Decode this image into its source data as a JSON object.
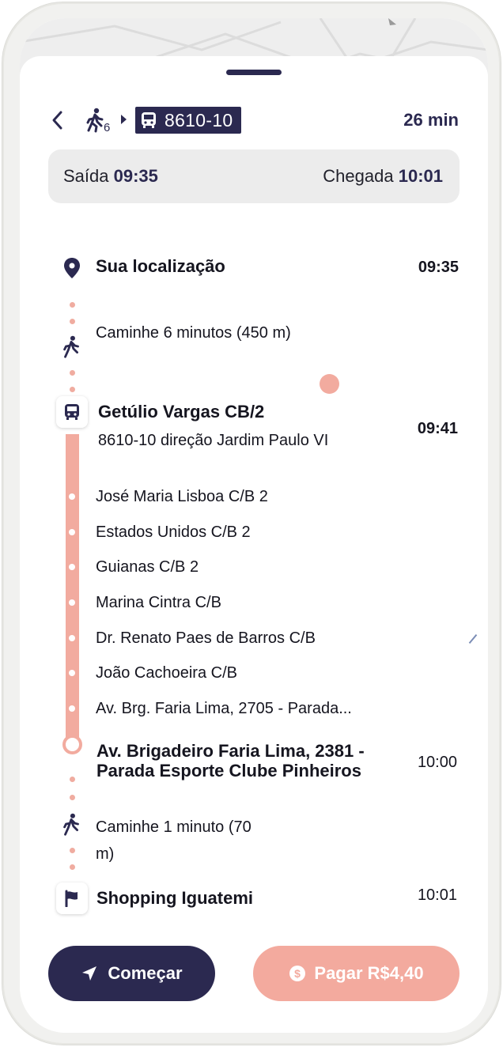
{
  "header": {
    "walk_minutes": "6",
    "route_number": "8610-10",
    "duration": "26 min"
  },
  "times": {
    "departure_label": "Saída",
    "departure_time": "09:35",
    "arrival_label": "Chegada",
    "arrival_time": "10:01"
  },
  "itinerary": {
    "origin": {
      "label": "Sua localização",
      "time": "09:35"
    },
    "walk1": {
      "text": "Caminhe 6 minutos (450 m)"
    },
    "board": {
      "stop": "Getúlio Vargas CB/2",
      "line": "8610-10 direção Jardim Paulo VI",
      "time": "09:41"
    },
    "stops": [
      "José Maria Lisboa C/B 2",
      "Estados Unidos C/B 2",
      "Guianas C/B 2",
      "Marina Cintra C/B",
      "Dr. Renato Paes de Barros C/B",
      "João Cachoeira C/B",
      "Av. Brg. Faria Lima, 2705 - Parada..."
    ],
    "alight": {
      "line1": "Av. Brigadeiro Faria Lima, 2381 -",
      "line2": "Parada Esporte Clube Pinheiros",
      "time": "10:00"
    },
    "walk2": {
      "line1": "Caminhe 1 minuto (70",
      "line2": "m)"
    },
    "destination": {
      "label": "Shopping Iguatemi",
      "time": "10:01"
    }
  },
  "actions": {
    "start_label": "Começar",
    "pay_label": "Pagar R$4,40"
  },
  "colors": {
    "primary": "#2b2950",
    "accent": "#f3aa9e"
  }
}
